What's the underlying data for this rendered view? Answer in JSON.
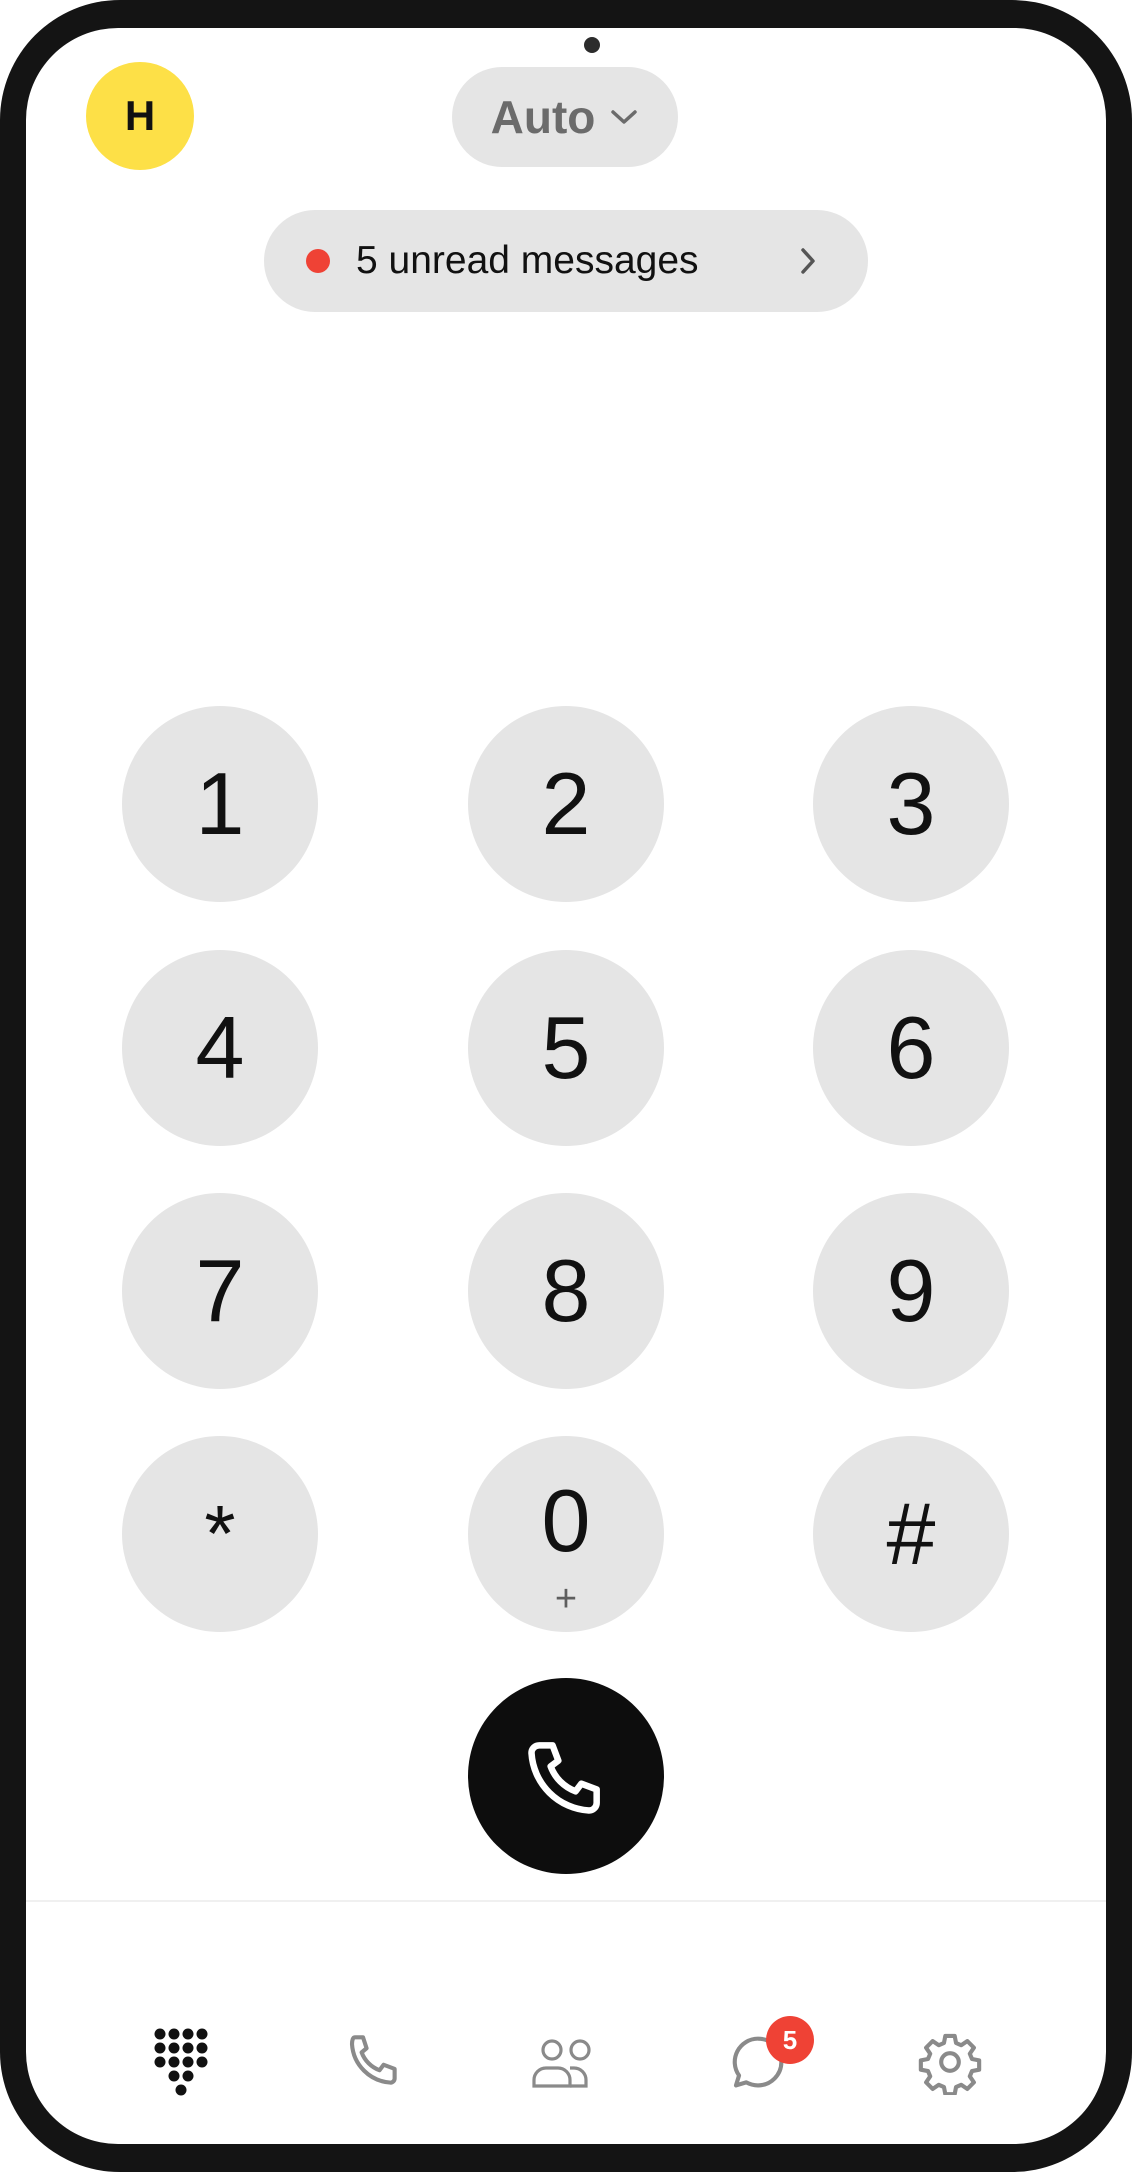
{
  "header": {
    "avatar_initial": "H",
    "mode_label": "Auto",
    "unread_label": "5 unread messages"
  },
  "keypad": [
    {
      "digit": "1",
      "sub": ""
    },
    {
      "digit": "2",
      "sub": ""
    },
    {
      "digit": "3",
      "sub": ""
    },
    {
      "digit": "4",
      "sub": ""
    },
    {
      "digit": "5",
      "sub": ""
    },
    {
      "digit": "6",
      "sub": ""
    },
    {
      "digit": "7",
      "sub": ""
    },
    {
      "digit": "8",
      "sub": ""
    },
    {
      "digit": "9",
      "sub": ""
    },
    {
      "digit": "*",
      "sub": ""
    },
    {
      "digit": "0",
      "sub": "+"
    },
    {
      "digit": "#",
      "sub": ""
    }
  ],
  "tabs": [
    {
      "icon": "dialpad-icon",
      "active": true
    },
    {
      "icon": "phone-icon",
      "active": false
    },
    {
      "icon": "contacts-icon",
      "active": false
    },
    {
      "icon": "messages-icon",
      "active": false,
      "badge": "5"
    },
    {
      "icon": "settings-icon",
      "active": false
    }
  ],
  "colors": {
    "accent_yellow": "#fde047",
    "badge_red": "#ef4235",
    "key_bg": "#e5e5e5",
    "call_button": "#0d0d0d"
  }
}
